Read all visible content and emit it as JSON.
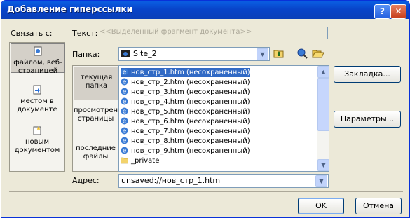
{
  "title": "Добавление гиперссылки",
  "link_to_label": "Связать с:",
  "text_label": "Текст:",
  "text_value": "<<Выделенный фрагмент документа>>",
  "folder_label": "Папка:",
  "folder_value": "Site_2",
  "address_label": "Адрес:",
  "address_value": "unsaved://нов_стр_1.htm",
  "link_bar": [
    {
      "label": "файлом, веб-страницей",
      "icon": "web-page-icon"
    },
    {
      "label": "местом в документе",
      "icon": "place-in-document-icon"
    },
    {
      "label": "новым документом",
      "icon": "new-document-icon"
    }
  ],
  "nav": [
    {
      "label": "текущая папка"
    },
    {
      "label": "просмотренные страницы"
    },
    {
      "label": "последние файлы"
    }
  ],
  "files": [
    "нов_стр_1.htm (несохраненный)",
    "нов_стр_2.htm (несохраненный)",
    "нов_стр_3.htm (несохраненный)",
    "нов_стр_4.htm (несохраненный)",
    "нов_стр_5.htm (несохраненный)",
    "нов_стр_6.htm (несохраненный)",
    "нов_стр_7.htm (несохраненный)",
    "нов_стр_8.htm (несохраненный)",
    "нов_стр_9.htm (несохраненный)",
    "_private"
  ],
  "buttons": {
    "bookmark": "Закладка...",
    "params": "Параметры...",
    "ok": "OK",
    "cancel": "Отмена"
  },
  "colors": {
    "titlebar": "#0a5fe3",
    "selection": "#316ac5",
    "dialog_bg": "#ece9d8"
  }
}
